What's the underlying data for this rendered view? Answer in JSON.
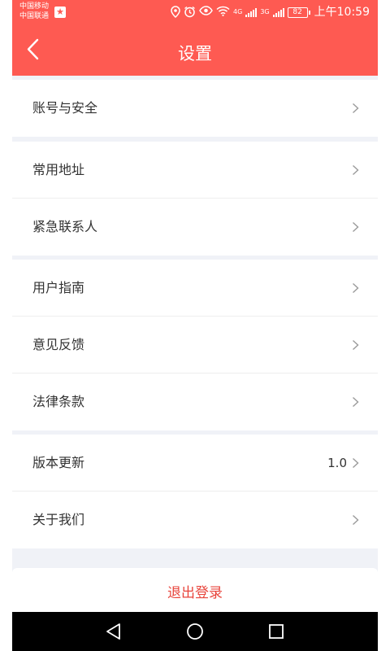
{
  "status_bar": {
    "carrier_1": "中国移动",
    "carrier_2": "中国联通",
    "network_1": "4G",
    "network_2": "3G",
    "battery": "82",
    "time": "上午10:59"
  },
  "header": {
    "title": "设置",
    "back_icon": "chevron-left-icon"
  },
  "groups": [
    {
      "items": [
        {
          "label": "账号与安全"
        }
      ]
    },
    {
      "items": [
        {
          "label": "常用地址"
        },
        {
          "label": "紧急联系人"
        }
      ]
    },
    {
      "items": [
        {
          "label": "用户指南"
        },
        {
          "label": "意见反馈"
        },
        {
          "label": "法律条款"
        }
      ]
    },
    {
      "items": [
        {
          "label": "版本更新",
          "value": "1.0"
        },
        {
          "label": "关于我们"
        }
      ]
    }
  ],
  "logout_label": "退出登录",
  "colors": {
    "accent": "#fe5a52",
    "page_bg": "#f0f2f7",
    "logout_text": "#e8453c"
  }
}
